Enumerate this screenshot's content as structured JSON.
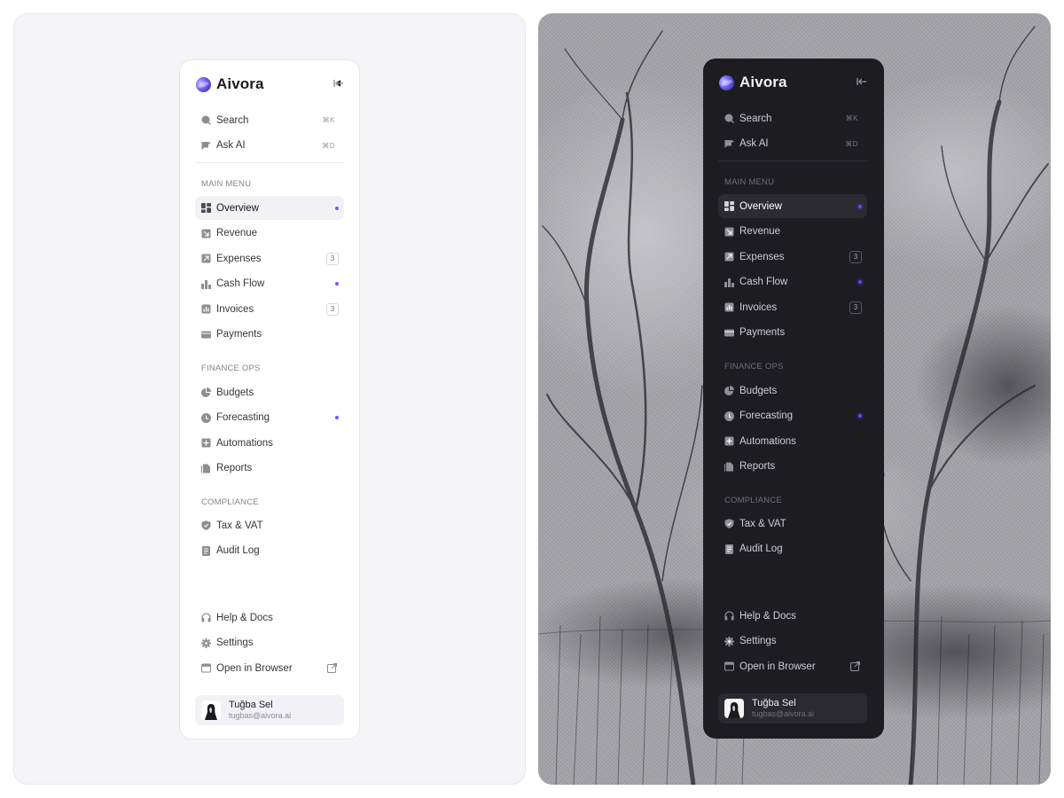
{
  "brand": {
    "name": "Aivora"
  },
  "colors": {
    "accent": "#6d5cf2",
    "light_bg": "#ffffff",
    "dark_bg": "#1d1c21"
  },
  "top_actions": [
    {
      "label": "Search",
      "shortcut": "⌘K",
      "icon": "search-icon"
    },
    {
      "label": "Ask AI",
      "shortcut": "⌘D",
      "icon": "chat-icon"
    }
  ],
  "sections": {
    "main_menu": "MAIN MENU",
    "finance_ops": "FINANCE OPS",
    "compliance": "COMPLIANCE"
  },
  "main_menu": [
    {
      "label": "Overview",
      "icon": "grid-icon",
      "active": true,
      "dot": true
    },
    {
      "label": "Revenue",
      "icon": "revenue-icon"
    },
    {
      "label": "Expenses",
      "icon": "expenses-icon",
      "badge": "3"
    },
    {
      "label": "Cash Flow",
      "icon": "bar-chart-icon",
      "dot": true
    },
    {
      "label": "Invoices",
      "icon": "invoice-icon",
      "badge": "3"
    },
    {
      "label": "Payments",
      "icon": "wallet-icon"
    }
  ],
  "finance_ops": [
    {
      "label": "Budgets",
      "icon": "pie-chart-icon"
    },
    {
      "label": "Forecasting",
      "icon": "clock-icon",
      "dot": true
    },
    {
      "label": "Automations",
      "icon": "automation-icon"
    },
    {
      "label": "Reports",
      "icon": "reports-icon"
    }
  ],
  "compliance": [
    {
      "label": "Tax & VAT",
      "icon": "shield-icon"
    },
    {
      "label": "Audit Log",
      "icon": "document-icon"
    }
  ],
  "footer": [
    {
      "label": "Help & Docs",
      "icon": "headphones-icon"
    },
    {
      "label": "Settings",
      "icon": "gear-icon"
    },
    {
      "label": "Open in Browser",
      "icon": "browser-icon",
      "external": true
    }
  ],
  "user": {
    "name": "Tuğba Sel",
    "email": "tugbas@aivora.ai"
  }
}
